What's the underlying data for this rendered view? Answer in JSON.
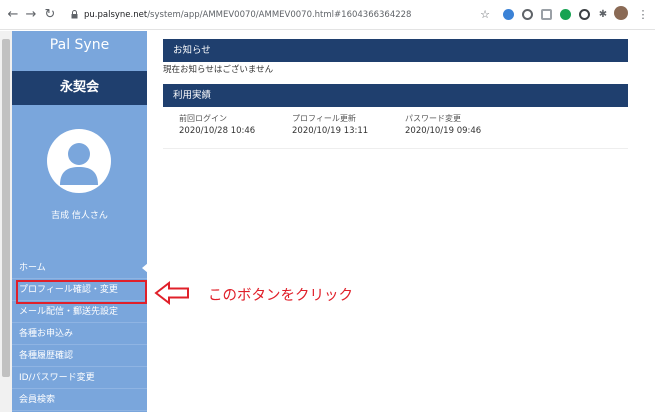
{
  "browser": {
    "back_icon": "arrow-left-icon",
    "forward_icon": "arrow-right-icon",
    "reload_icon": "reload-icon",
    "url_host": "pu.palsyne.net",
    "url_path": "/system/app/AMMEV0070/AMMEV0070.html#1604366364228"
  },
  "sidebar": {
    "logo": "Pal Syne",
    "org_name": "永契会",
    "user_name": "吉成 信人さん",
    "menu": [
      {
        "label": "ホーム"
      },
      {
        "label": "プロフィール確認・変更"
      },
      {
        "label": "メール配信・郵送先設定"
      },
      {
        "label": "各種お申込み"
      },
      {
        "label": "各種履歴確認"
      },
      {
        "label": "ID/パスワード変更"
      },
      {
        "label": "会員検索"
      }
    ]
  },
  "annotation": {
    "text": "このボタンをクリック"
  },
  "main": {
    "notice_title": "お知らせ",
    "notice_text": "現在お知らせはございません",
    "usage_title": "利用実績",
    "usage": [
      {
        "label": "前回ログイン",
        "value": "2020/10/28 10:46"
      },
      {
        "label": "プロフィール更新",
        "value": "2020/10/19 13:11"
      },
      {
        "label": "パスワード変更",
        "value": "2020/10/19 09:46"
      }
    ]
  },
  "colors": {
    "sidebar_bg": "#7aa6dc",
    "header_navy": "#1f3f6e",
    "annotation_red": "#e0202a"
  }
}
